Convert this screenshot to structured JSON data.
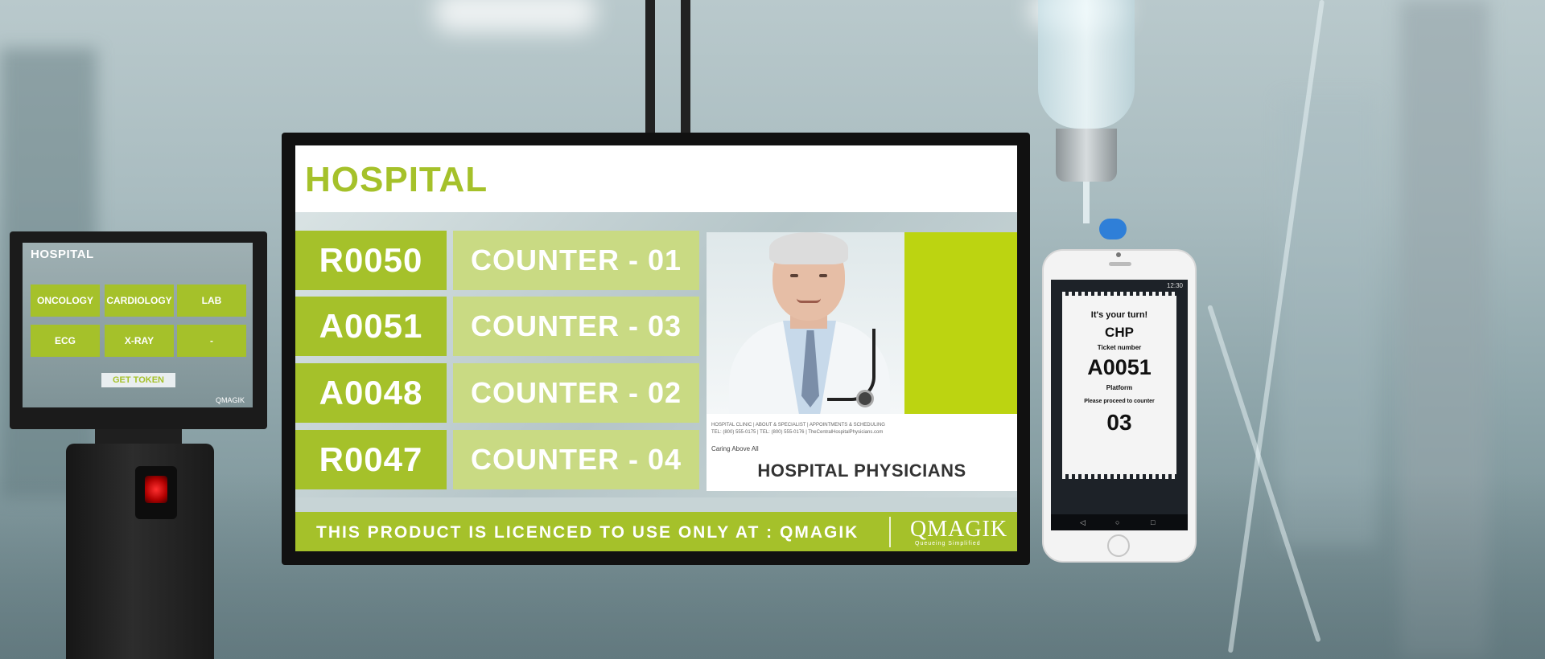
{
  "kiosk": {
    "title": "HOSPITAL",
    "buttons": [
      "ONCOLOGY",
      "CARDIOLOGY",
      "LAB",
      "ECG",
      "X-RAY",
      "-"
    ],
    "token_button": "GET TOKEN",
    "brand": "QMAGIK"
  },
  "display": {
    "title": "HOSPITAL",
    "queue": [
      {
        "token": "R0050",
        "counter": "COUNTER - 01"
      },
      {
        "token": "A0051",
        "counter": "COUNTER - 03"
      },
      {
        "token": "A0048",
        "counter": "COUNTER - 02"
      },
      {
        "token": "R0047",
        "counter": "COUNTER - 04"
      }
    ],
    "ad": {
      "fine_print": "HOSPITAL CLINIC | ABOUT & SPECIALIST | APPOINTMENTS & SCHEDULING  TEL: (800) 555-0175 | TEL: (800) 555-0176 | TheCentralHospitalPhysicians.com",
      "tagline": "Caring Above All",
      "caption": "HOSPITAL PHYSICIANS"
    },
    "ticker": {
      "text": "THIS PRODUCT IS LICENCED TO USE ONLY AT :  QMAGIK",
      "brand": "QMAGIK",
      "brand_sub": "Queueing Simplified"
    }
  },
  "phone": {
    "status_time": "12:30",
    "ticket": {
      "heading": "It's your turn!",
      "service": "CHP",
      "number_label": "Ticket number",
      "number": "A0051",
      "platform_label": "Platform",
      "instruction": "Please proceed to counter",
      "counter": "03"
    }
  },
  "colors": {
    "accent": "#a5c12a",
    "accent_light": "#c9da83",
    "ad_green": "#bcd411"
  }
}
